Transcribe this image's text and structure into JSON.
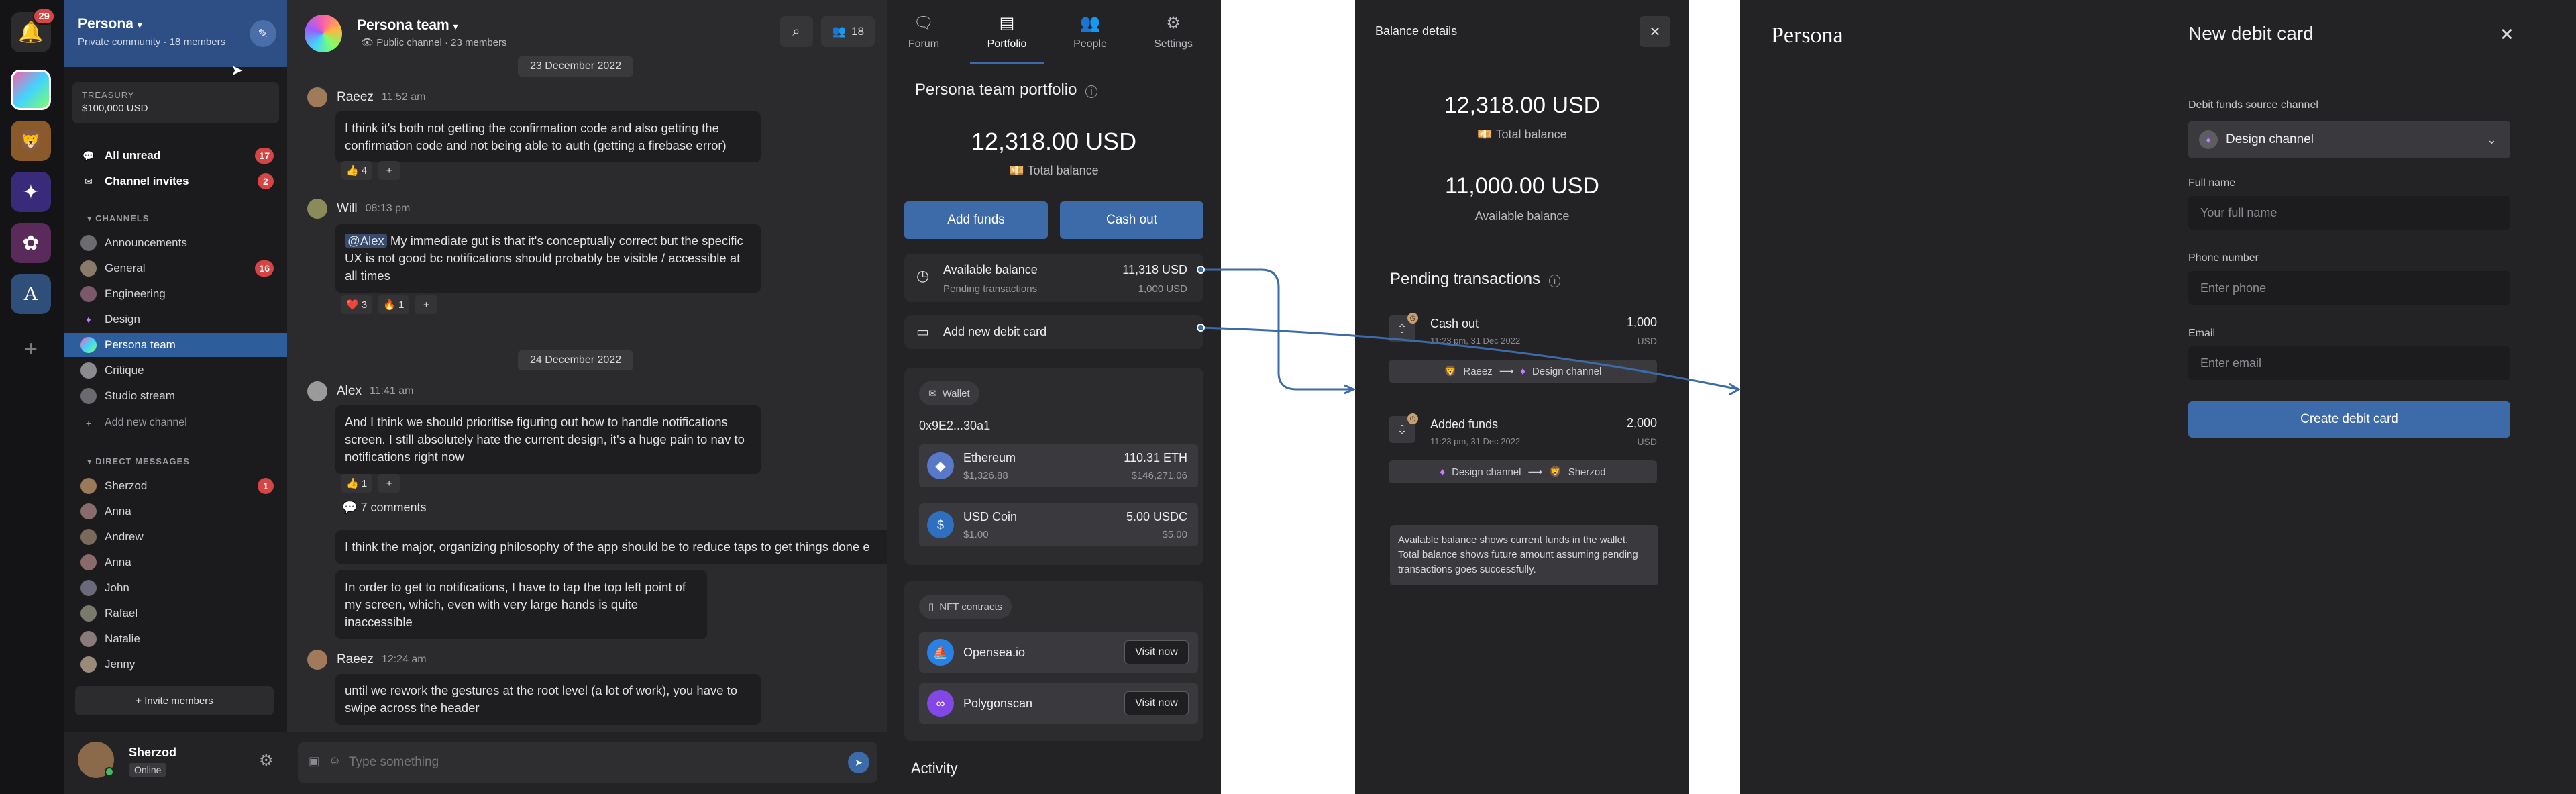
{
  "rail": {
    "notif_badge": "29",
    "plus": "+"
  },
  "sidebar": {
    "community_name": "Persona",
    "community_type": "Private community",
    "member_count": "18 members",
    "treasury_label": "TREASURY",
    "treasury_value": "$100,000 USD",
    "all_unread": "All unread",
    "all_unread_count": "17",
    "channel_invites": "Channel invites",
    "channel_invites_count": "2",
    "channels_header": "CHANNELS",
    "channels": [
      {
        "label": "Announcements",
        "count": ""
      },
      {
        "label": "General",
        "count": "16"
      },
      {
        "label": "Engineering",
        "count": ""
      },
      {
        "label": "Design",
        "count": ""
      },
      {
        "label": "Persona team",
        "count": ""
      },
      {
        "label": "Critique",
        "count": ""
      },
      {
        "label": "Studio stream",
        "count": ""
      }
    ],
    "add_channel": "Add new channel",
    "dm_header": "DIRECT MESSAGES",
    "dms": [
      {
        "label": "Sherzod",
        "count": "1"
      },
      {
        "label": "Anna",
        "count": ""
      },
      {
        "label": "Andrew",
        "count": ""
      },
      {
        "label": "Anna",
        "count": ""
      },
      {
        "label": "John",
        "count": ""
      },
      {
        "label": "Rafael",
        "count": ""
      },
      {
        "label": "Natalie",
        "count": ""
      },
      {
        "label": "Jenny",
        "count": ""
      }
    ],
    "invite_button": "+ Invite members",
    "user_name": "Sherzod",
    "user_status": "Online"
  },
  "chat": {
    "title": "Persona team",
    "channel_type": "Public channel",
    "members": "23 members",
    "member_count_btn": "18",
    "top_date": "23 December 2022",
    "messages": [
      {
        "author": "Raeez",
        "time": "11:52 am",
        "text": "I think it's both not getting the confirmation code and also getting the confirmation code and not being able to auth (getting a firebase error)",
        "reactions": [
          "👍 4"
        ]
      },
      {
        "author": "Will",
        "time": "08:13 pm",
        "mention": "@Alex",
        "text": " My immediate gut is that it's conceptually correct but the specific UX is not good bc notifications should probably be visible / accessible at all times",
        "reactions": [
          "❤️ 3",
          "🔥 1"
        ]
      },
      {
        "author": "Alex",
        "time": "11:41 am",
        "text": "And I think we should prioritise figuring out how to handle notifications screen. I still absolutely hate the current design, it's a huge pain to nav to notifications right now",
        "reactions": [
          "👍 1"
        ],
        "comments": "7 comments"
      },
      {
        "author": "",
        "time": "",
        "text": "I think the major, organizing philosophy of the app should be to reduce taps to get things done e"
      },
      {
        "author": "",
        "time": "",
        "text": "In order to get to notifications, I have to tap the top left point of my screen, which, even with very large hands is quite inaccessible"
      },
      {
        "author": "Raeez",
        "time": "12:24 am",
        "text": "until we rework the gestures at the root level (a lot of work), you have to swipe across the header"
      }
    ],
    "date_divider": "24 December 2022",
    "composer_placeholder": "Type something",
    "react_add": "+"
  },
  "portfolio": {
    "tabs": [
      "Forum",
      "Portfolio",
      "People",
      "Settings"
    ],
    "title": "Persona team portfolio",
    "total_amount": "12,318.00 USD",
    "total_label": "Total balance",
    "add_funds": "Add funds",
    "cash_out": "Cash out",
    "available_label": "Available balance",
    "available_value": "11,318 USD",
    "pending_label": "Pending transactions",
    "pending_value": "1,000 USD",
    "add_card": "Add new debit card",
    "wallet_label": "Wallet",
    "wallet_address": "0x9E2...30a1",
    "assets": [
      {
        "name": "Ethereum",
        "fiat": "$1,326.88",
        "amount": "110.31 ETH",
        "value": "$146,271.06"
      },
      {
        "name": "USD Coin",
        "fiat": "$1.00",
        "amount": "5.00 USDC",
        "value": "$5.00"
      }
    ],
    "nft_label": "NFT contracts",
    "nfts": [
      {
        "name": "Opensea.io",
        "action": "Visit now"
      },
      {
        "name": "Polygonscan",
        "action": "Visit now"
      }
    ],
    "activity": "Activity"
  },
  "balance_details": {
    "title": "Balance details",
    "total_amount": "12,318.00 USD",
    "total_label": "Total balance",
    "available_amount": "11,000.00 USD",
    "available_label": "Available balance",
    "pending_title": "Pending transactions",
    "transactions": [
      {
        "label": "Cash out",
        "time": "11:23 pm, 31 Dec 2022",
        "amount": "1,000",
        "currency": "USD",
        "from": "Raeez",
        "to": "Design channel"
      },
      {
        "label": "Added funds",
        "time": "11:23 pm, 31 Dec 2022",
        "amount": "2,000",
        "currency": "USD",
        "from": "Design channel",
        "to": "Sherzod"
      }
    ],
    "note": "Available balance shows current funds in the wallet. Total balance shows future amount assuming pending transactions goes successfully."
  },
  "debit_card": {
    "brand": "Persona",
    "title": "New debit card",
    "source_label": "Debit funds source channel",
    "source_value": "Design channel",
    "name_label": "Full name",
    "name_placeholder": "Your full name",
    "phone_label": "Phone number",
    "phone_placeholder": "Enter phone",
    "email_label": "Email",
    "email_placeholder": "Enter email",
    "submit": "Create debit card"
  },
  "colors": {
    "accent": "#3d6aa8",
    "header": "#2e4f86",
    "badge": "#d64545",
    "connector": "#3d6aa8"
  }
}
